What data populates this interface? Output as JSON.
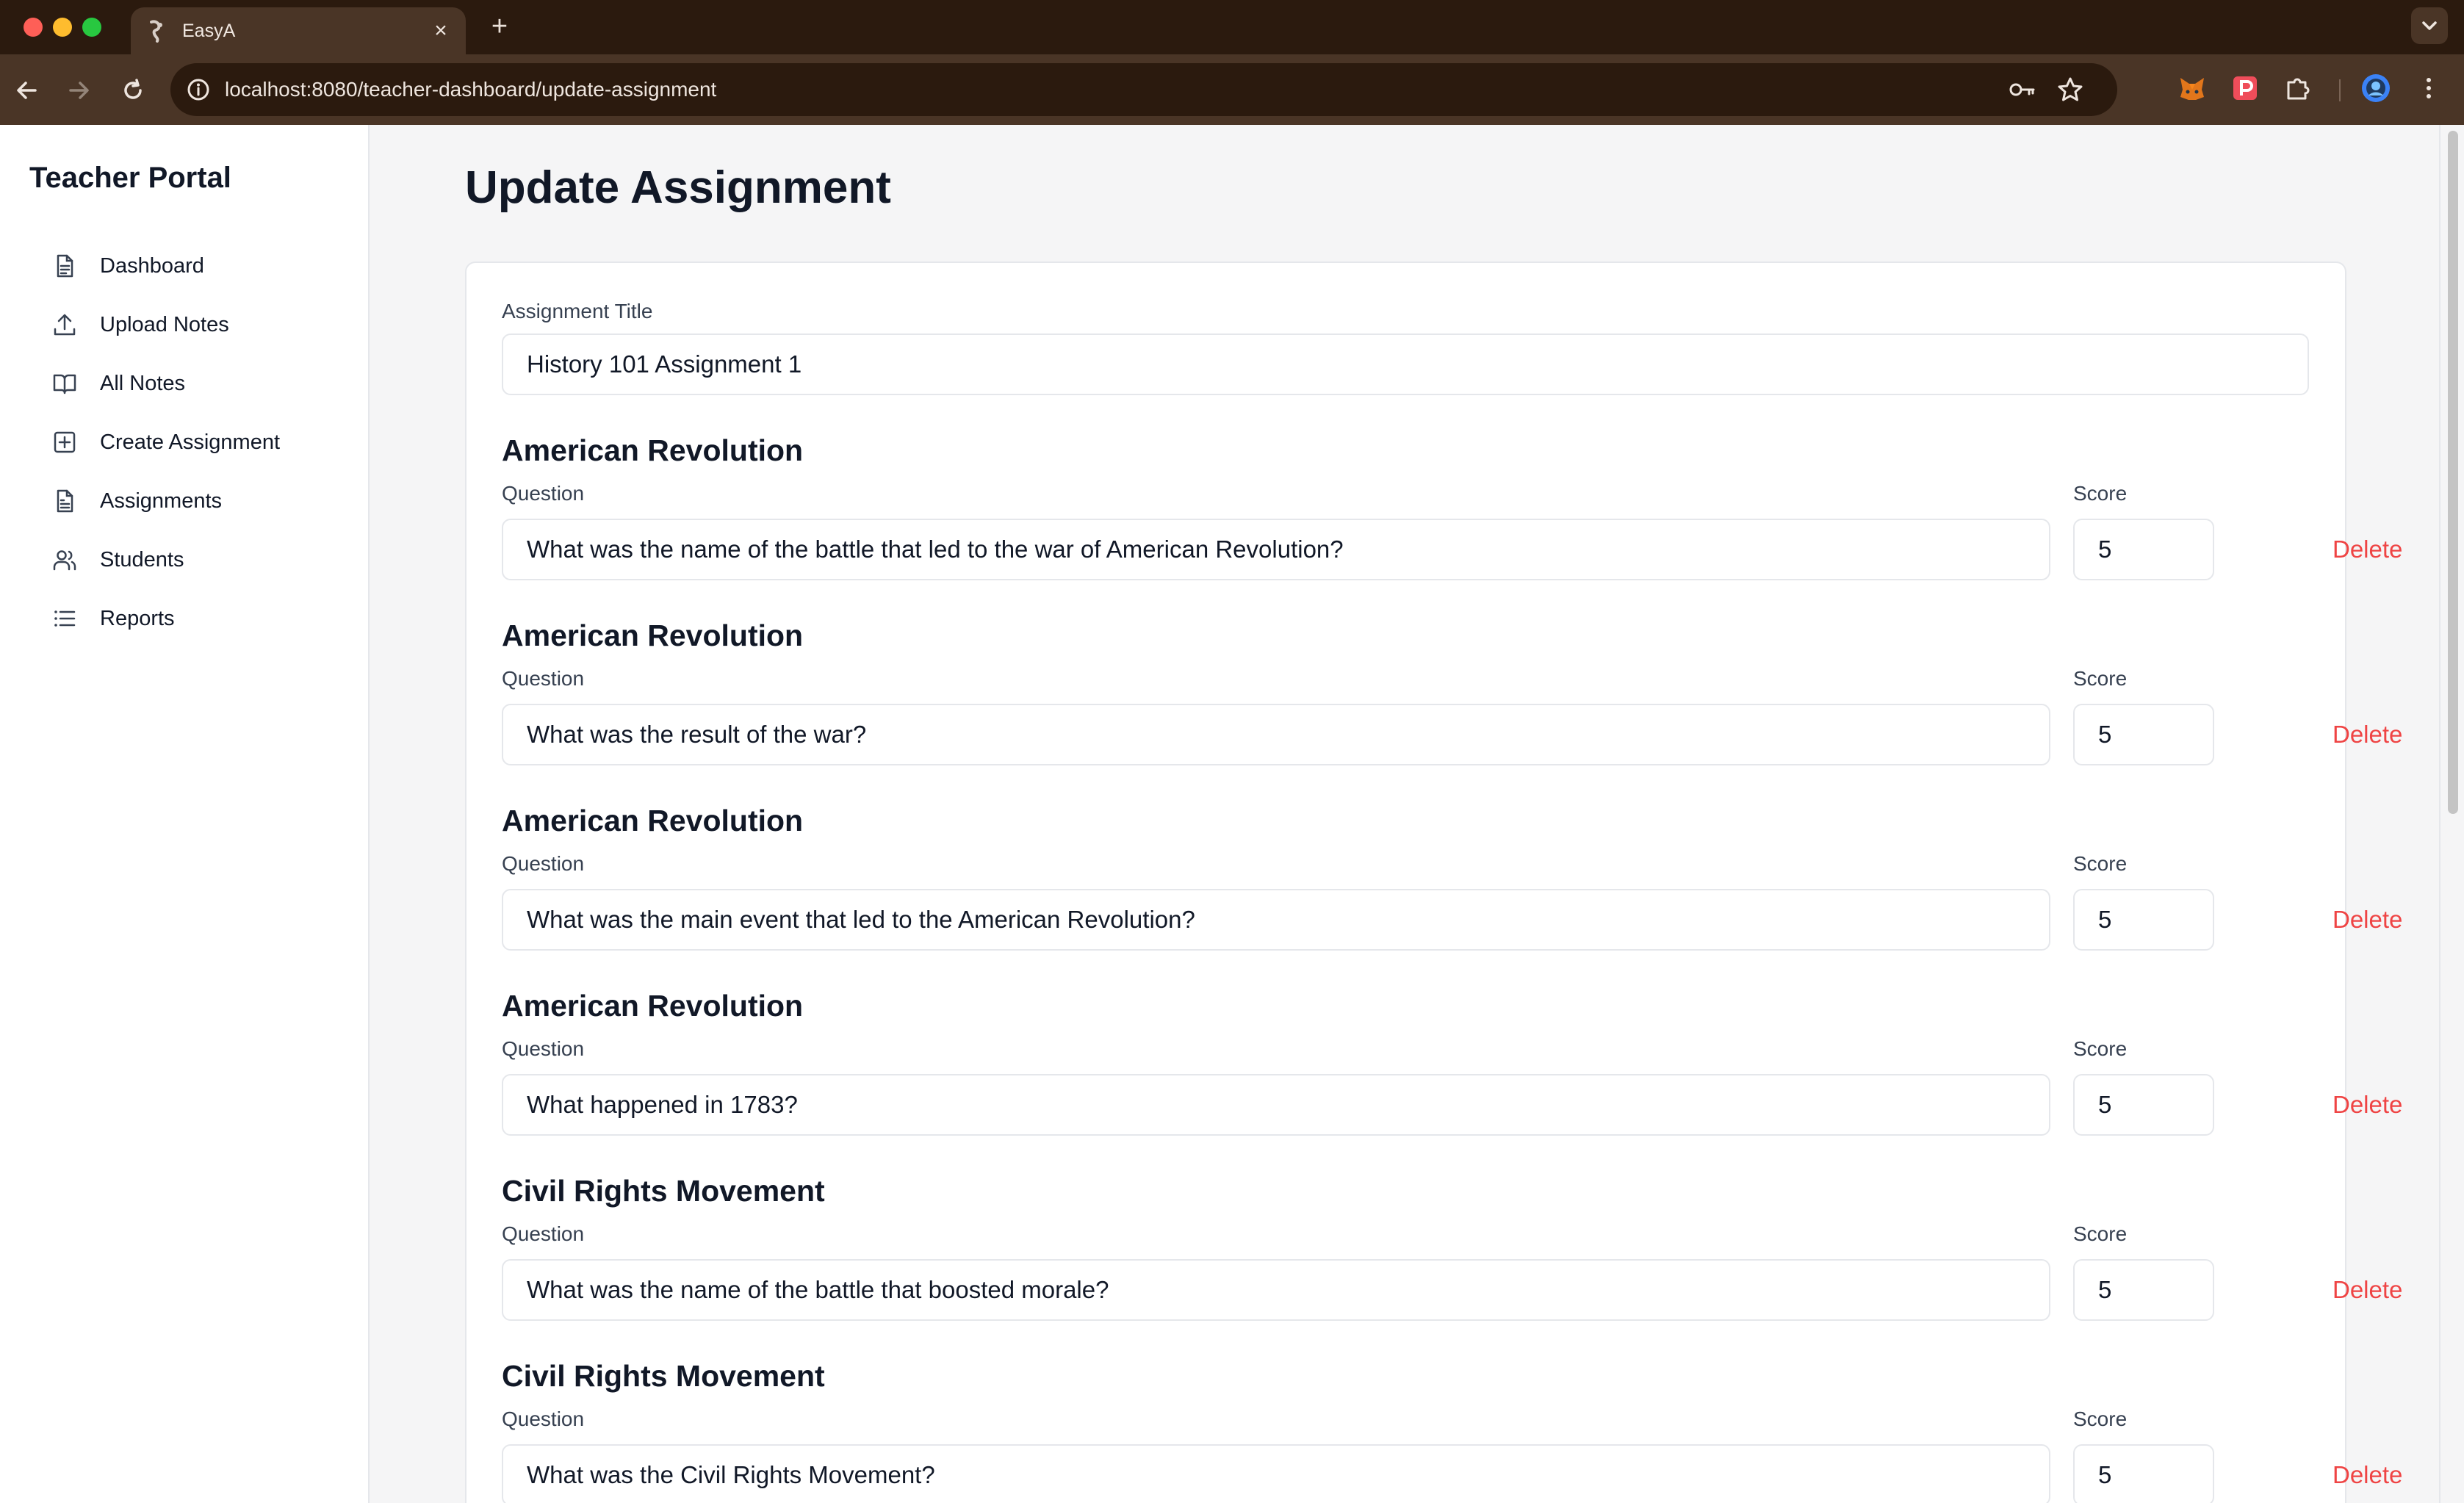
{
  "browser": {
    "tab_title": "EasyA",
    "tab_close": "×",
    "new_tab": "+",
    "url": "localhost:8080/teacher-dashboard/update-assignment"
  },
  "sidebar": {
    "brand": "Teacher Portal",
    "items": [
      {
        "label": "Dashboard",
        "icon": "document-icon"
      },
      {
        "label": "Upload Notes",
        "icon": "upload-icon"
      },
      {
        "label": "All Notes",
        "icon": "book-open-icon"
      },
      {
        "label": "Create Assignment",
        "icon": "plus-square-icon"
      },
      {
        "label": "Assignments",
        "icon": "file-text-icon"
      },
      {
        "label": "Students",
        "icon": "users-icon"
      },
      {
        "label": "Reports",
        "icon": "list-icon"
      }
    ]
  },
  "main": {
    "page_title": "Update Assignment",
    "assignment_title_label": "Assignment Title",
    "assignment_title_value": "History 101 Assignment 1",
    "question_label": "Question",
    "score_label": "Score",
    "delete_label": "Delete",
    "questions": [
      {
        "topic": "American Revolution",
        "question": "What was the name of the battle that led to the war of American Revolution?",
        "score": "5"
      },
      {
        "topic": "American Revolution",
        "question": "What was the result of the war?",
        "score": "5"
      },
      {
        "topic": "American Revolution",
        "question": "What was the main event that led to the American Revolution?",
        "score": "5"
      },
      {
        "topic": "American Revolution",
        "question": "What happened in 1783?",
        "score": "5"
      },
      {
        "topic": "Civil Rights Movement",
        "question": "What was the name of the battle that boosted morale?",
        "score": "5"
      },
      {
        "topic": "Civil Rights Movement",
        "question": "What was the Civil Rights Movement?",
        "score": "5"
      }
    ]
  },
  "colors": {
    "chrome_dark": "#2b1a0e",
    "chrome_toolbar": "#4a3526",
    "delete": "#ef4444",
    "page_bg": "#f5f5f6"
  }
}
